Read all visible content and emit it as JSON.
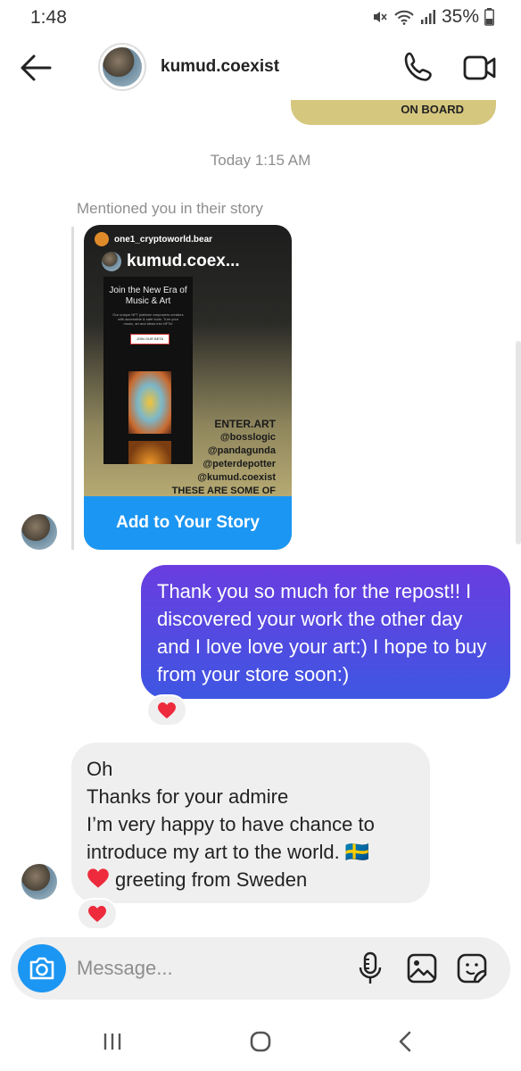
{
  "status_bar": {
    "time": "1:48",
    "battery": "35%",
    "icons": [
      "mute-icon",
      "wifi-icon",
      "signal-icon",
      "battery-icon"
    ]
  },
  "header": {
    "username": "kumud.coexist",
    "back_icon": "arrow-left-icon",
    "call_icon": "phone-icon",
    "video_icon": "video-camera-icon"
  },
  "chat": {
    "previous_bubble_text": "ON BOARD",
    "day_stamp": "Today 1:15 AM",
    "mention_label": "Mentioned you in their story",
    "story": {
      "author": "one1_cryptoworld.bear",
      "mention": "kumud.coex...",
      "promo_title": "Join the New Era of Music & Art",
      "promo_fine": "Our unique NFT platform empowers creators with accessible & safe tools. Turn your music, art and ideas into NFTs!",
      "promo_button": "JOIN OUR BETA",
      "overlay_lines": [
        "ENTER.ART",
        "@bosslogic",
        "@pandagunda",
        "@peterdepotter",
        "@kumud.coexist",
        "THESE ARE SOME OF"
      ],
      "cta": "Add to Your Story"
    },
    "sent_message": "Thank you so much for the repost!! I discovered your work the other day and I love love your art:) I hope to buy from your store soon:)",
    "received_message_lines": [
      "Oh",
      "Thanks for your admire",
      "I’m very happy to have chance to",
      "introduce my art to the world. 🇸🇪",
      "greeting from Sweden"
    ],
    "reaction": "❤️",
    "colors": {
      "sent_bubble_top": "#6a3de0",
      "sent_bubble_bottom": "#3e56e2",
      "received_bubble": "#efefef",
      "cta_blue": "#1b96f2",
      "heart_red": "#ed2b3c"
    }
  },
  "composer": {
    "placeholder": "Message...",
    "camera_icon": "camera-icon",
    "mic_icon": "microphone-icon",
    "gallery_icon": "image-icon",
    "sticker_icon": "sticker-icon"
  },
  "nav_bar": {
    "icons": [
      "recent-apps-icon",
      "home-icon",
      "back-icon"
    ]
  }
}
